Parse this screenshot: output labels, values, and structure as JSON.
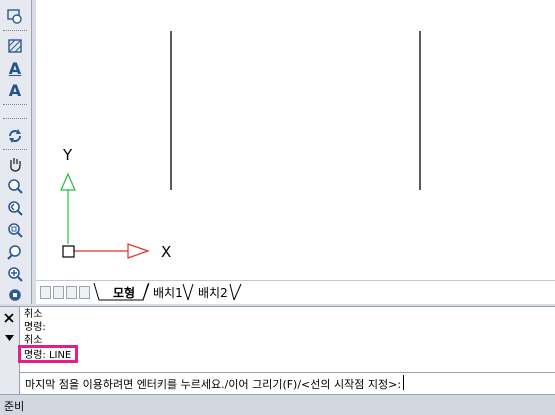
{
  "toolbar": {
    "icons": [
      "region-icon",
      "hatch-icon",
      "text-a-icon",
      "text-a2-icon",
      "regen-icon",
      "pan-icon",
      "zoom-realtime-icon",
      "zoom-previous-icon",
      "zoom-window-icon",
      "zoom-dynamic-icon",
      "zoom-in-icon",
      "zoom-out-icon"
    ],
    "text_a": "A",
    "text_a2": "A"
  },
  "canvas": {
    "ucs_y": "Y",
    "ucs_x": "X",
    "ucs_y_color": "#21c33a",
    "ucs_x_color": "#e0322d"
  },
  "tabs": {
    "model": "모형",
    "layout1": "배치1",
    "layout2": "배치2"
  },
  "command": {
    "history": [
      "취소",
      "명령:",
      "취소",
      "명령: LINE"
    ],
    "prompt": "마지막 점을 이용하려면 엔터키를 누르세요./이어 그리기(F)/<선의 시작점 지정>:",
    "highlight_color": "#e0218a"
  },
  "status": {
    "text": "준비"
  }
}
